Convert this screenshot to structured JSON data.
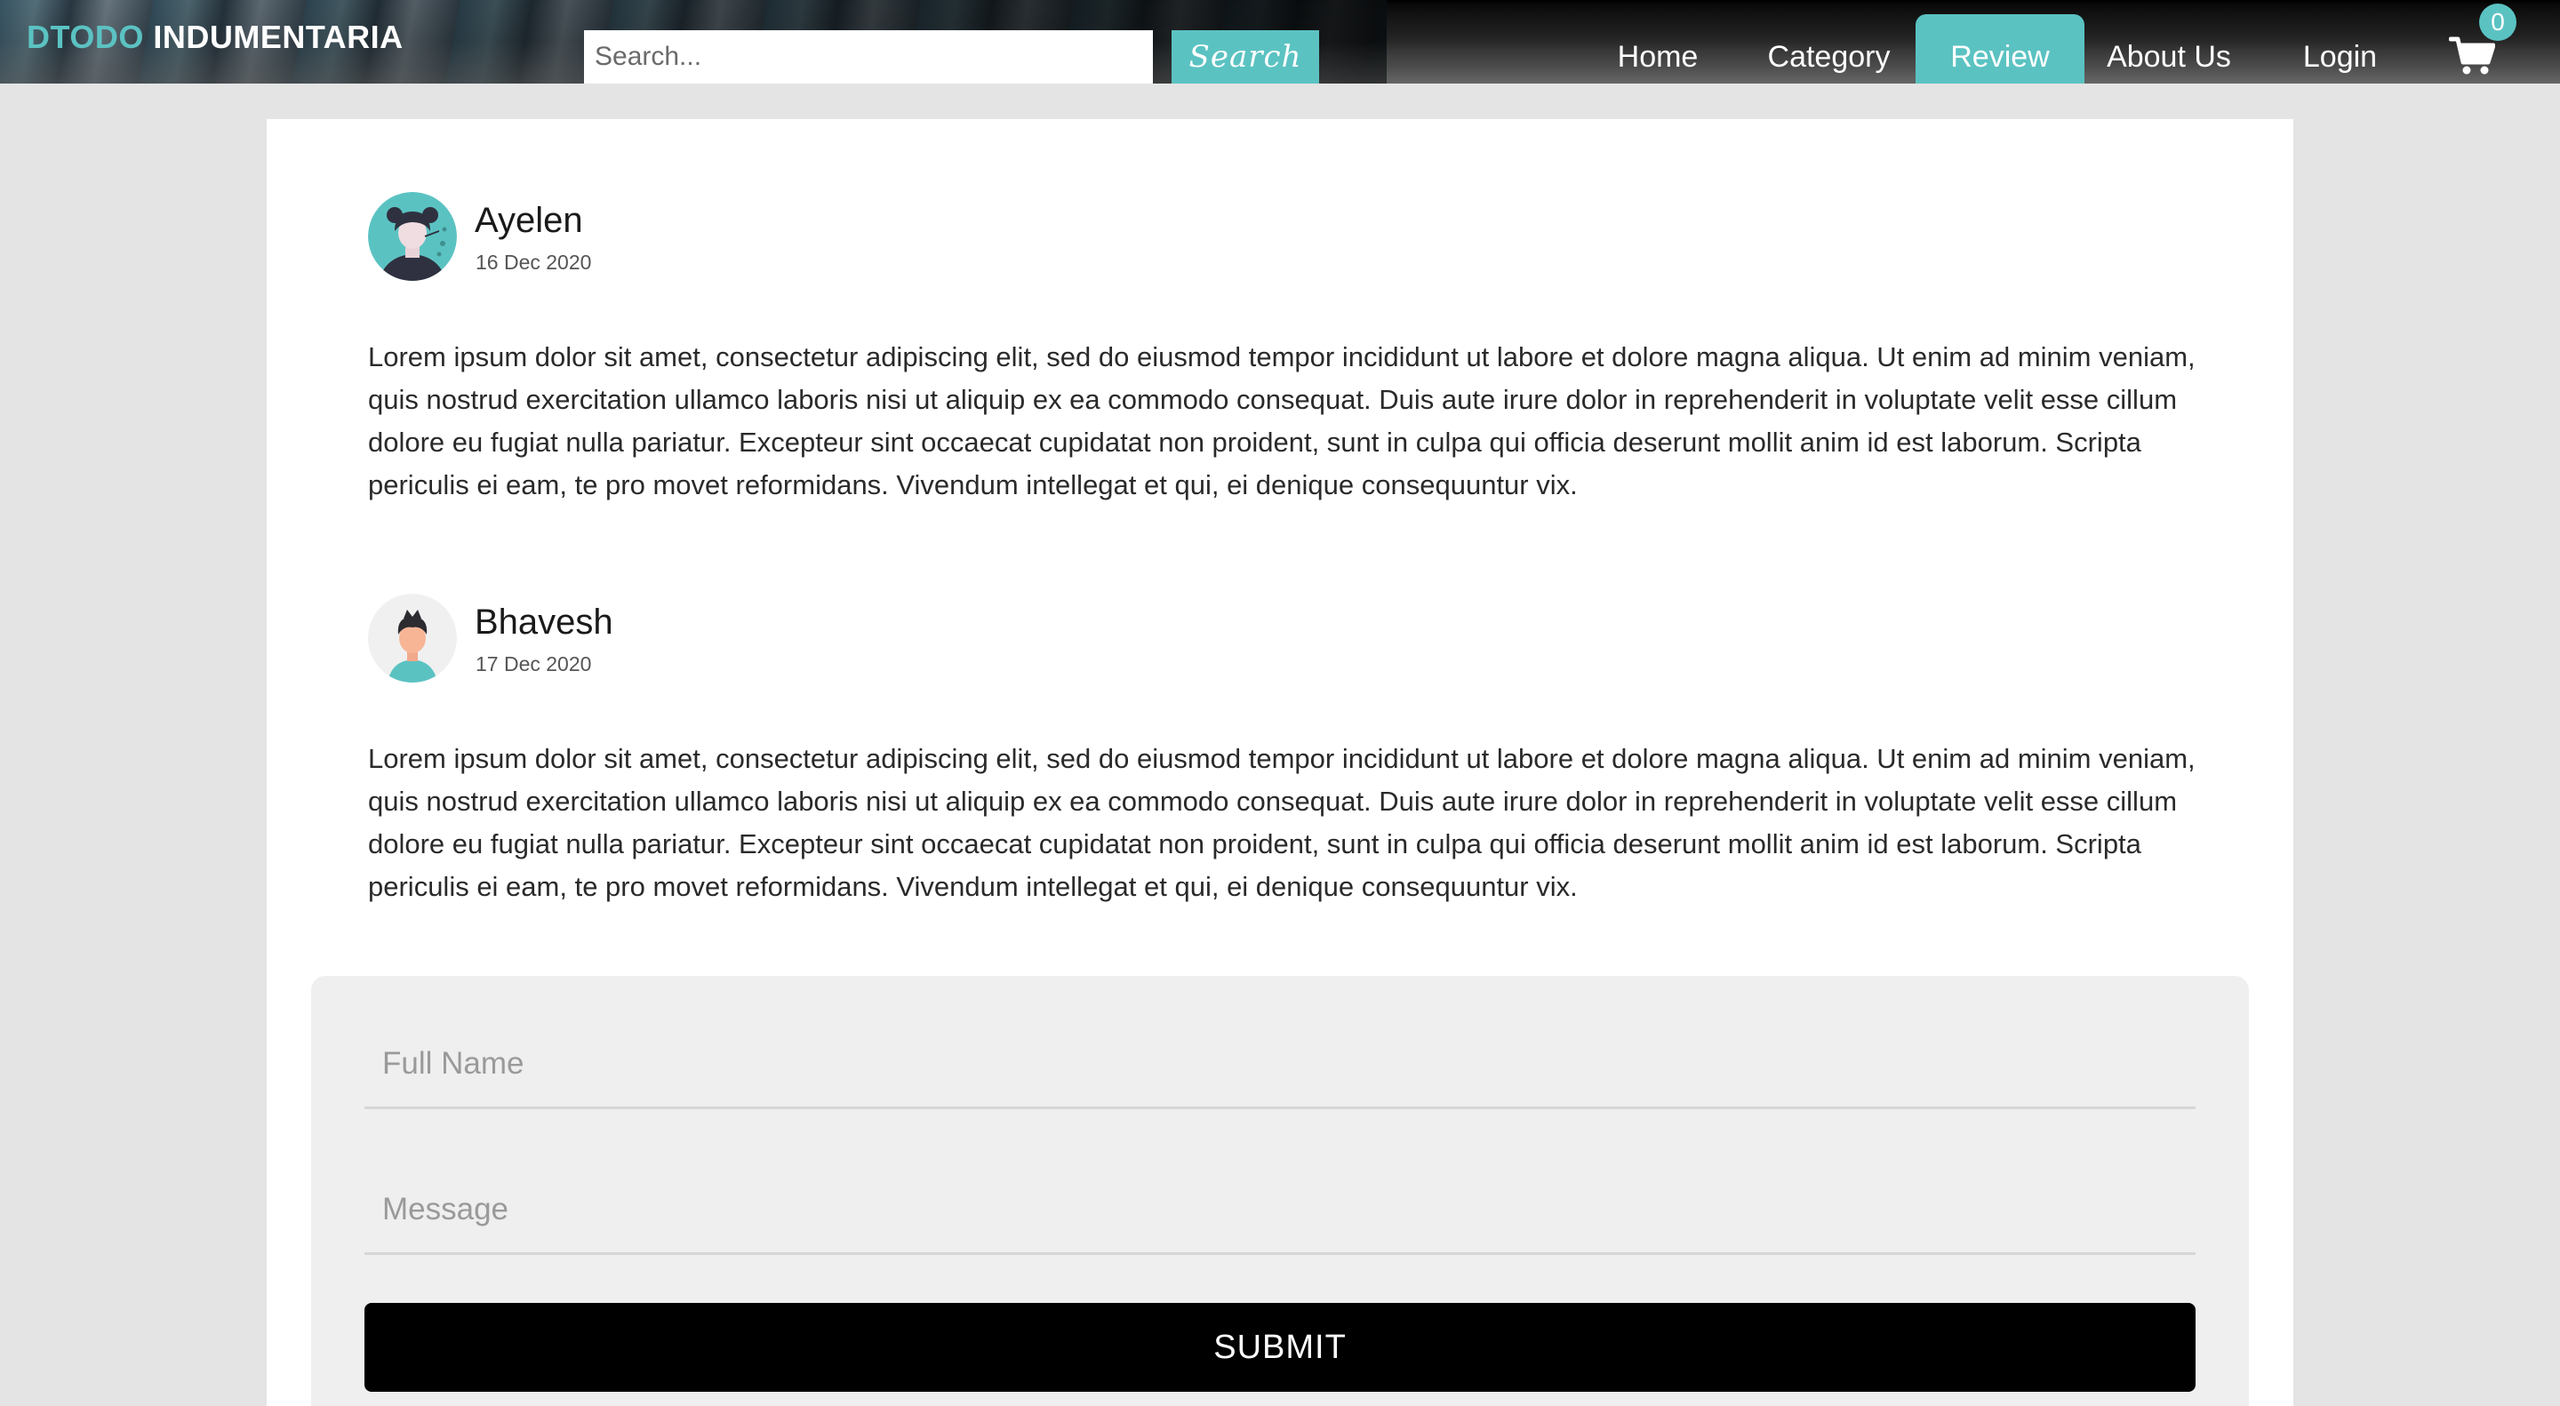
{
  "brand": {
    "accent": "DTODO",
    "main": "INDUMENTARIA"
  },
  "search": {
    "placeholder": "Search...",
    "button_label": "Search"
  },
  "nav": {
    "home": "Home",
    "category": "Category",
    "review": "Review",
    "about": "About Us",
    "login": "Login"
  },
  "cart": {
    "count": "0",
    "icon": "shopping-cart-icon"
  },
  "colors": {
    "accent": "#5bc2c2",
    "submit": "#000000",
    "page_bg": "#e4e4e4"
  },
  "reviews": [
    {
      "name": "Ayelen",
      "date": "16 Dec 2020",
      "avatar_icon": "female-avatar-icon",
      "text": "Lorem ipsum dolor sit amet, consectetur adipiscing elit, sed do eiusmod tempor incididunt ut labore et dolore magna aliqua. Ut enim ad minim veniam, quis nostrud exercitation ullamco laboris nisi ut aliquip ex ea commodo consequat. Duis aute irure dolor in reprehenderit in voluptate velit esse cillum dolore eu fugiat nulla pariatur. Excepteur sint occaecat cupidatat non proident, sunt in culpa qui officia deserunt mollit anim id est laborum. Scripta periculis ei eam, te pro movet reformidans. Vivendum intellegat et qui, ei denique consequuntur vix."
    },
    {
      "name": "Bhavesh",
      "date": "17 Dec 2020",
      "avatar_icon": "male-avatar-icon",
      "text": "Lorem ipsum dolor sit amet, consectetur adipiscing elit, sed do eiusmod tempor incididunt ut labore et dolore magna aliqua. Ut enim ad minim veniam, quis nostrud exercitation ullamco laboris nisi ut aliquip ex ea commodo consequat. Duis aute irure dolor in reprehenderit in voluptate velit esse cillum dolore eu fugiat nulla pariatur. Excepteur sint occaecat cupidatat non proident, sunt in culpa qui officia deserunt mollit anim id est laborum. Scripta periculis ei eam, te pro movet reformidans. Vivendum intellegat et qui, ei denique consequuntur vix."
    }
  ],
  "form": {
    "name_placeholder": "Full Name",
    "message_placeholder": "Message",
    "submit_label": "SUBMIT"
  }
}
